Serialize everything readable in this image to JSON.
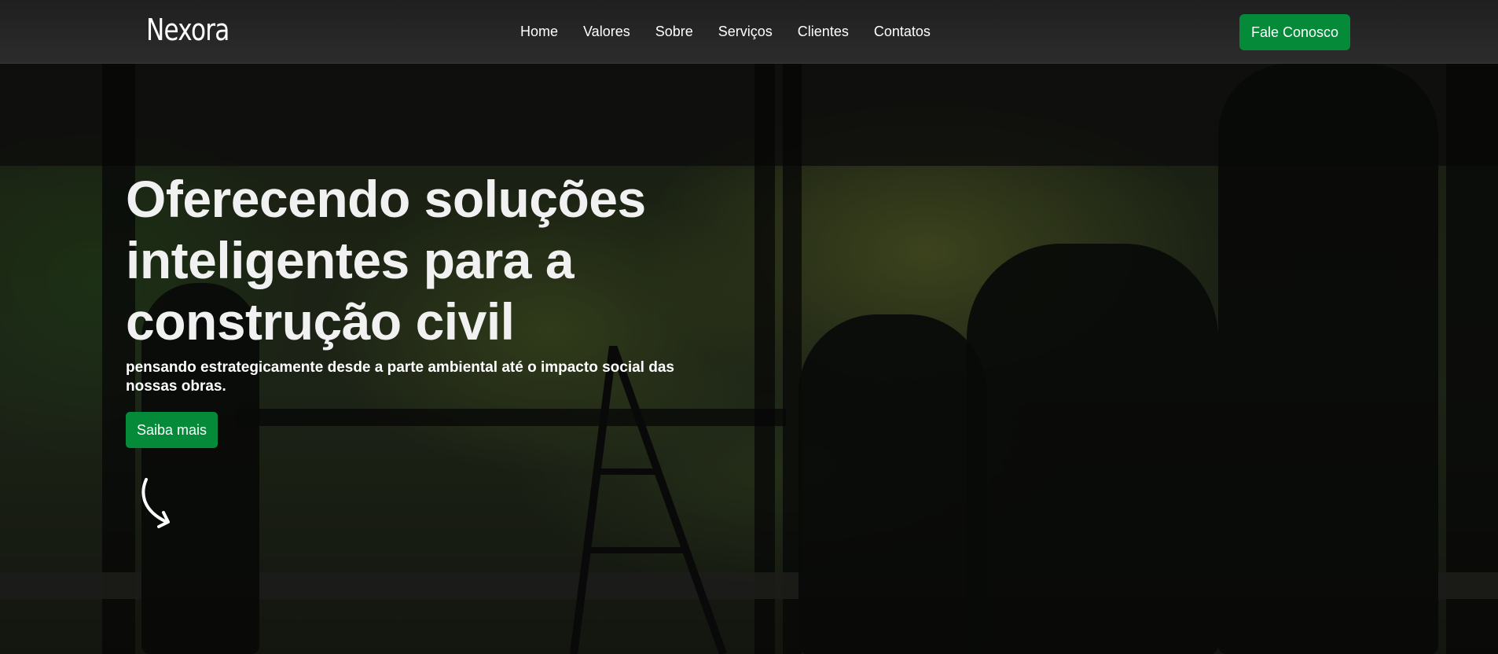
{
  "brand": {
    "logo": "Nexora"
  },
  "nav": {
    "links": [
      "Home",
      "Valores",
      "Sobre",
      "Serviços",
      "Clientes",
      "Contatos"
    ],
    "cta_label": "Fale Conosco"
  },
  "hero": {
    "headline_lines": [
      "Oferecendo soluções",
      "inteligentes para a",
      "construção civil"
    ],
    "subheadline": "pensando estrategicamente desde a parte ambiental até o impacto social das nossas obras.",
    "button_label": "Saiba mais",
    "arrow_icon": "curved-arrow-down-icon"
  },
  "colors": {
    "accent": "#058a3a",
    "navbar": "#262626",
    "text": "#ffffff"
  }
}
